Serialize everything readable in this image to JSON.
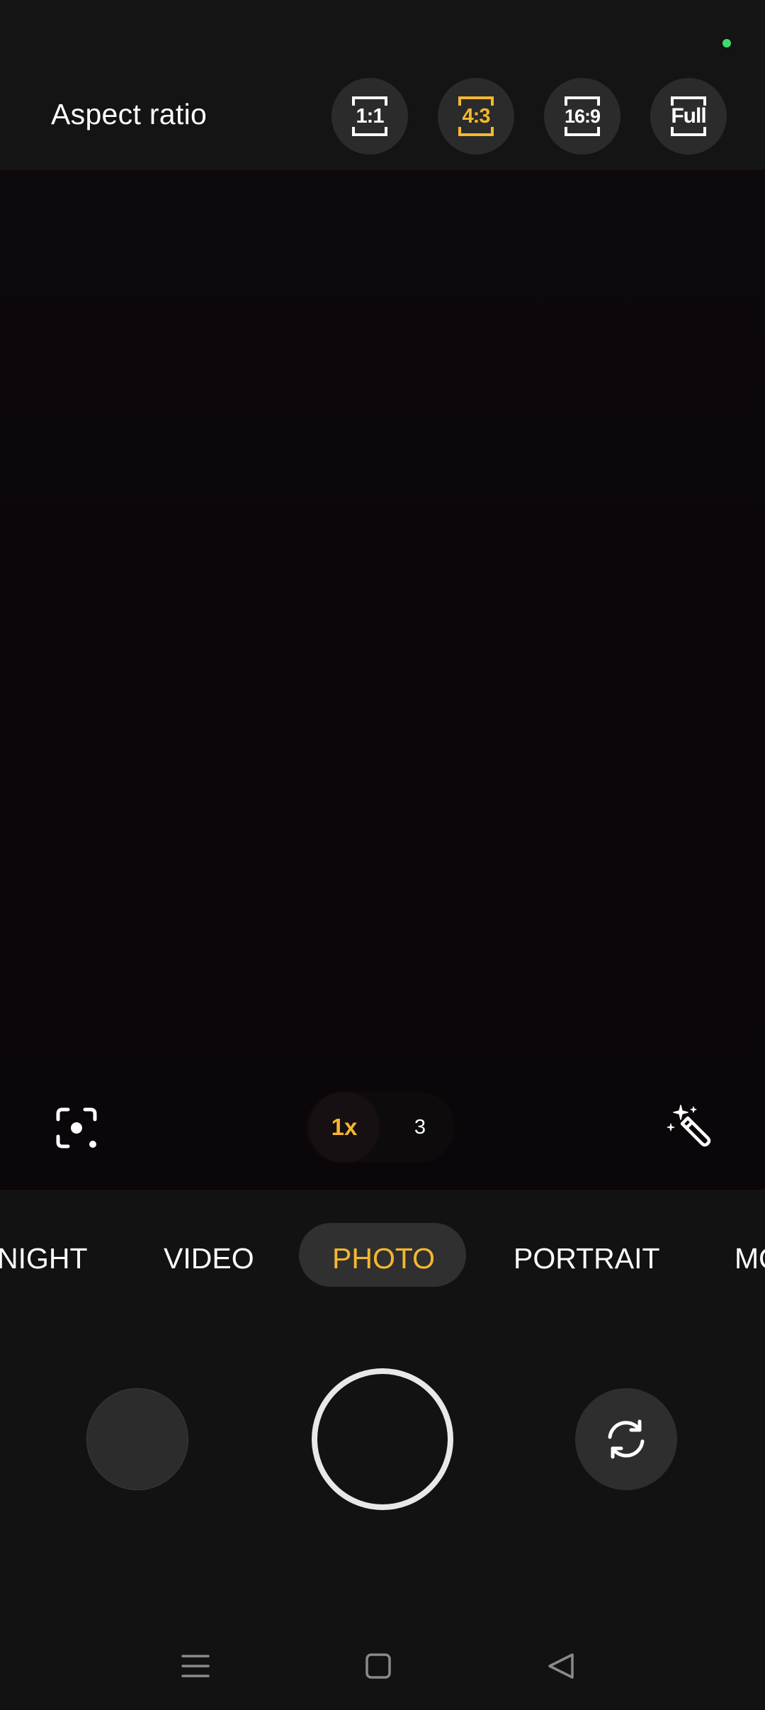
{
  "colors": {
    "accent": "#f5b82e",
    "status_dot": "#3ddc6a",
    "text": "#ffffff",
    "nav_icon": "#8a8a8a"
  },
  "aspect_ratio": {
    "title": "Aspect ratio",
    "options": [
      {
        "label": "1:1",
        "selected": false
      },
      {
        "label": "4:3",
        "selected": true
      },
      {
        "label": "16:9",
        "selected": false
      },
      {
        "label": "Full",
        "selected": false
      }
    ]
  },
  "viewfinder": {
    "left_icon": "focus-lock-icon",
    "right_icon": "magic-wand-icon",
    "zoom": {
      "active": "1x",
      "other": "3"
    }
  },
  "modes": {
    "items": [
      "NIGHT",
      "VIDEO",
      "PHOTO",
      "PORTRAIT",
      "MO"
    ],
    "selected": "PHOTO"
  },
  "controls": {
    "gallery_icon": "gallery-thumbnail",
    "shutter_icon": "shutter-button",
    "switch_icon": "switch-camera-icon"
  },
  "navigation": {
    "menu_icon": "menu-icon",
    "home_icon": "home-icon",
    "back_icon": "back-icon"
  }
}
